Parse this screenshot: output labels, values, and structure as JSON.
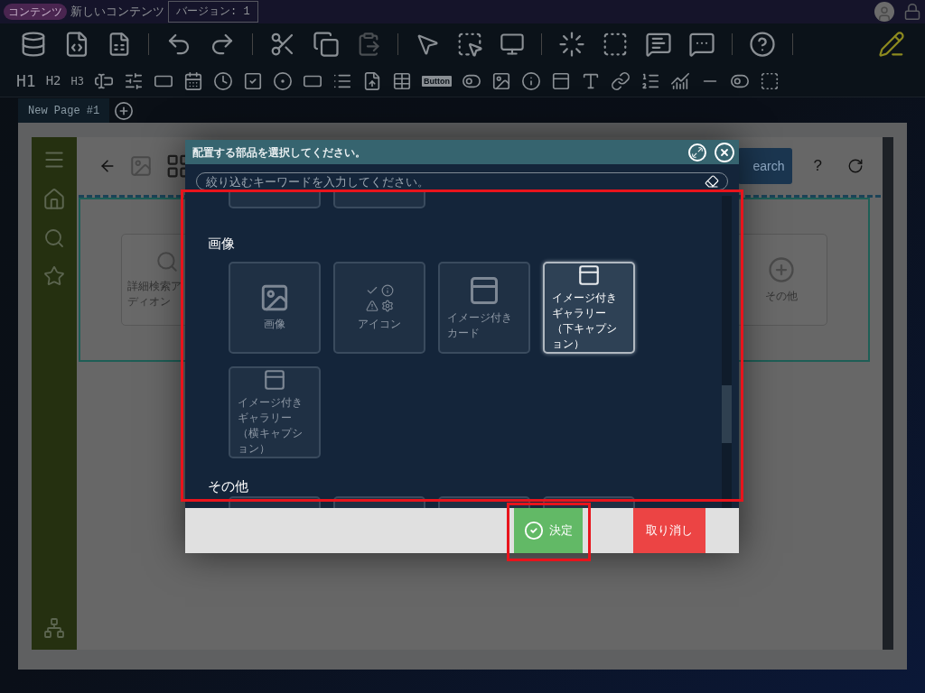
{
  "app_bar": {
    "badge": "コンテンツ",
    "title": "新しいコンテンツ",
    "version": "バージョン: 1"
  },
  "toolbar": {
    "headings": [
      "H1",
      "H2",
      "H3"
    ],
    "button_widget": "Button"
  },
  "tabs": [
    {
      "label": "New Page #1",
      "selected": true
    }
  ],
  "page": {
    "search_button": "earch",
    "help": "?",
    "cards": [
      {
        "kind": "search",
        "lines": [
          "詳細検索ア",
          "ディオン"
        ]
      },
      {
        "kind": "plus",
        "lines": [
          "その他"
        ]
      }
    ]
  },
  "dialog": {
    "title": "配置する部品を選択してください。",
    "search": {
      "placeholder": "絞り込むキーワードを入力してください。"
    },
    "sections": [
      {
        "items": [
          {
            "kind": "blank",
            "selected": false
          },
          {
            "kind": "blank",
            "selected": false
          }
        ]
      },
      {
        "heading": "画像",
        "items": [
          {
            "kind": "image",
            "label": "画像",
            "selected": false
          },
          {
            "kind": "status",
            "label": "アイコン",
            "selected": false
          },
          {
            "kind": "card",
            "label": "イメージ付きカード",
            "selected": false
          },
          {
            "kind": "card",
            "label": "イメージ付きギャラリー（下キャプション）",
            "selected": true
          },
          {
            "kind": "card",
            "label": "イメージ付きギャラリー（横キャプション）",
            "selected": false
          }
        ]
      },
      {
        "heading": "その他",
        "items": [
          {
            "kind": "blank",
            "selected": false
          },
          {
            "kind": "blank",
            "selected": false
          },
          {
            "kind": "blank",
            "selected": false
          },
          {
            "kind": "blank",
            "selected": false
          }
        ]
      }
    ],
    "buttons": [
      {
        "kind": "confirm",
        "label": "決定"
      },
      {
        "kind": "cancel",
        "label": "取り消し"
      }
    ]
  }
}
